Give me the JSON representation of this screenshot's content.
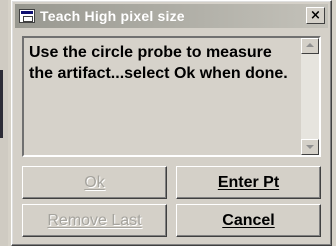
{
  "dialog": {
    "title": "Teach High pixel size",
    "close_label": "×",
    "message": "Use the circle probe to measure the artifact...select Ok when done.",
    "buttons": {
      "ok": "Ok",
      "enter_pt": "Enter Pt",
      "remove_last": "Remove Last",
      "cancel": "Cancel"
    },
    "button_states": {
      "ok": "disabled",
      "enter_pt": "enabled",
      "remove_last": "disabled",
      "cancel": "enabled"
    },
    "icons": {
      "app": "window-app-icon",
      "close": "close-icon",
      "scroll_up": "scroll-up-arrow-icon",
      "scroll_down": "scroll-down-arrow-icon"
    }
  }
}
